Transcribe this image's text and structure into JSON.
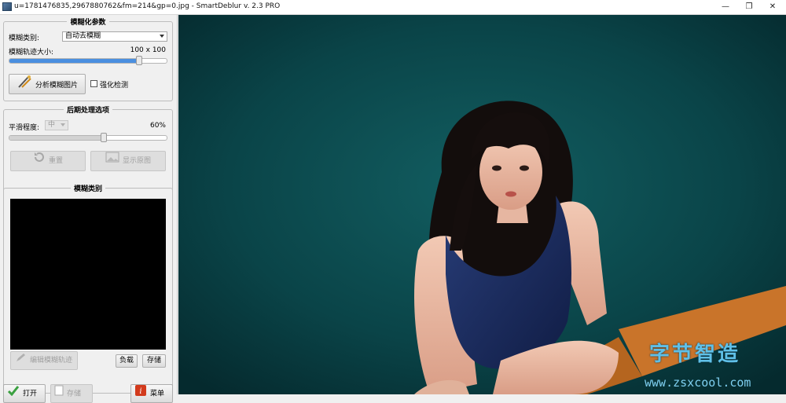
{
  "window": {
    "title": "u=1781476835,2967880762&fm=214&gp=0.jpg - SmartDeblur v. 2.3 PRO",
    "min_glyph": "—",
    "max_glyph": "❐",
    "close_glyph": "✕"
  },
  "blur_params": {
    "title": "模糊化参数",
    "type_label": "模糊类别:",
    "type_value": "自动去模糊",
    "size_label": "模糊轨迹大小:",
    "size_value": "100 x 100",
    "size_level": 0.82,
    "analyze_button": "分析模糊图片",
    "enhance_label": "强化检测",
    "enhance_checked": false
  },
  "post_process": {
    "title": "后期处理选项",
    "smooth_label": "平滑程度:",
    "smooth_value": "中",
    "smooth_percent": "60%",
    "smooth_level": 0.6,
    "reset_button": "重置",
    "show_original_button": "显示原图"
  },
  "blur_type": {
    "title": "模糊类别",
    "edit_button": "编辑模糊轨迹",
    "load_button": "负载",
    "save_button": "存储"
  },
  "bottom": {
    "open_button": "打开",
    "save_button": "存储",
    "menu_button": "菜单"
  },
  "watermark": {
    "cn": "字节智造",
    "url": "www.zsxcool.com"
  },
  "colors": {
    "accent": "#4a8fe0",
    "photo_bg": "#0a4347",
    "watermark": "#5fc0e8"
  }
}
